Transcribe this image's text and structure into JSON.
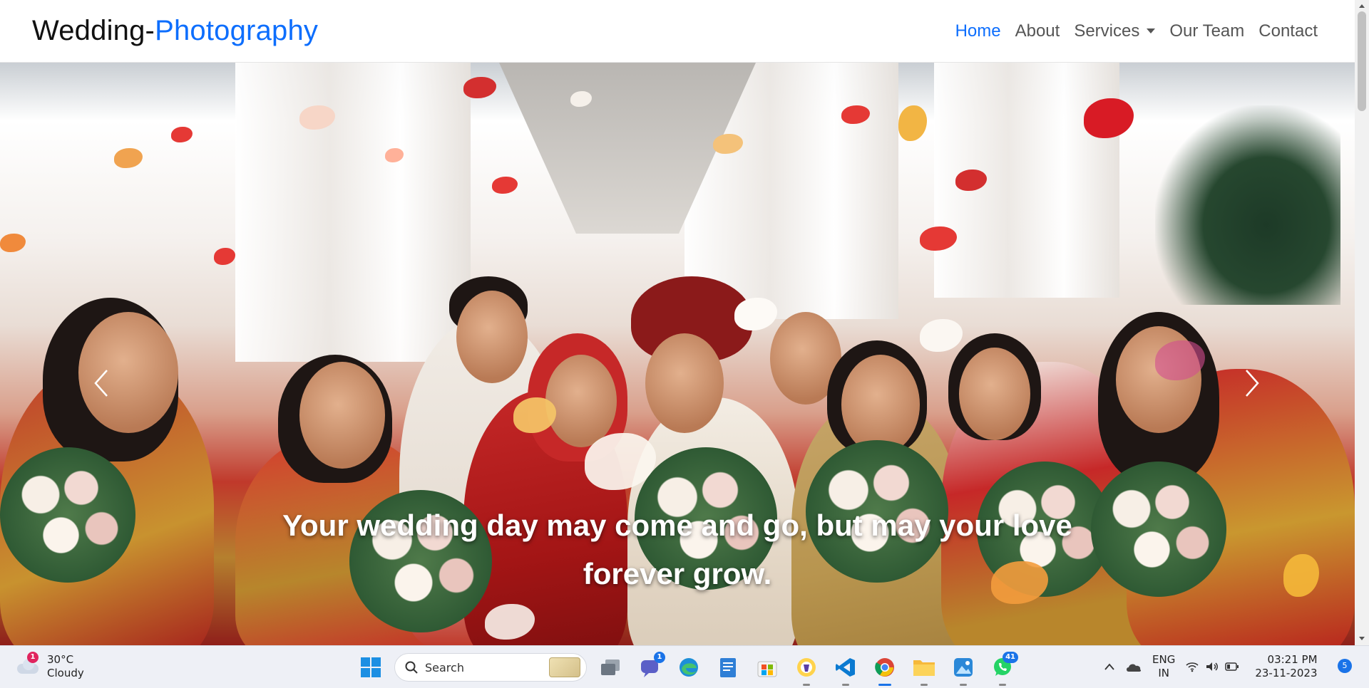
{
  "navbar": {
    "brand_main": "Wedding-",
    "brand_accent": "Photography",
    "links": [
      {
        "label": "Home",
        "active": true
      },
      {
        "label": "About"
      },
      {
        "label": "Services",
        "dropdown": true
      },
      {
        "label": "Our Team"
      },
      {
        "label": "Contact"
      }
    ]
  },
  "hero": {
    "caption_line1": "Your wedding day may come and go, but may your love",
    "caption_line2": "forever grow.",
    "indicator_count": 3,
    "active_indicator": 2
  },
  "taskbar": {
    "weather": {
      "badge": "1",
      "temp": "30°C",
      "condition": "Cloudy"
    },
    "search_label": "Search",
    "apps": [
      {
        "name": "task-view",
        "badge": ""
      },
      {
        "name": "teams-chat",
        "badge": "1"
      },
      {
        "name": "edge",
        "badge": ""
      },
      {
        "name": "notepad",
        "badge": ""
      },
      {
        "name": "microsoft-store",
        "badge": ""
      },
      {
        "name": "brave",
        "badge": ""
      },
      {
        "name": "vscode",
        "badge": ""
      },
      {
        "name": "chrome",
        "badge": ""
      },
      {
        "name": "file-explorer",
        "badge": ""
      },
      {
        "name": "photos",
        "badge": ""
      },
      {
        "name": "whatsapp",
        "badge": "41"
      }
    ],
    "tray": {
      "lang_line1": "ENG",
      "lang_line2": "IN",
      "time": "03:21 PM",
      "date": "23-11-2023",
      "notification_count": "5"
    }
  },
  "colors": {
    "accent": "#0d6efd",
    "nav_text": "#555555",
    "taskbar_bg": "#eef0f6"
  }
}
